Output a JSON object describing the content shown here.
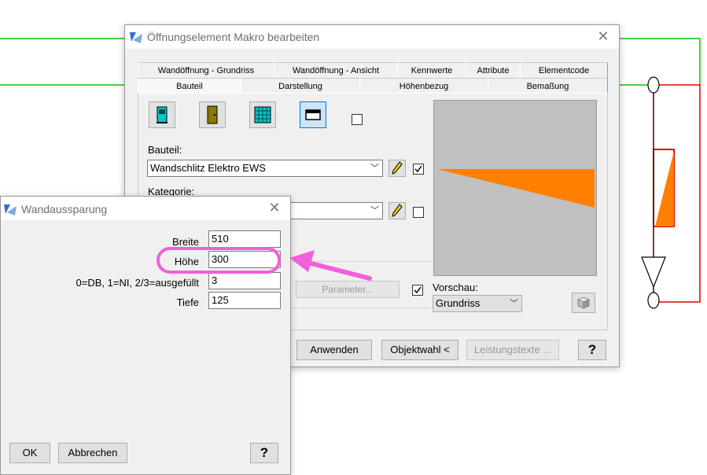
{
  "main_dialog": {
    "title": "Öffnungselement Makro bearbeiten",
    "tabs_row1": [
      "Wandöffnung - Grundriss",
      "Wandöffnung - Ansicht",
      "Kennwerte",
      "Attribute",
      "Elementcode"
    ],
    "tabs_row2": [
      "Bauteil",
      "Darstellung",
      "Höhenbezug",
      "Bemaßung"
    ],
    "bauteil_label": "Bauteil:",
    "bauteil_value": "Wandschlitz Elektro EWS",
    "kategorie_label": "Kategorie:",
    "parameter_button": "Parameter...",
    "vorschau_label": "Vorschau:",
    "vorschau_value": "Grundriss",
    "buttons": {
      "anwenden": "Anwenden",
      "objektwahl": "Objektwahl <",
      "leistungstexte": "Leistungstexte ...",
      "help": "?"
    }
  },
  "wand_dialog": {
    "title": "Wandaussparung",
    "fields": [
      {
        "label": "Breite",
        "value": "510"
      },
      {
        "label": "Höhe",
        "value": "300"
      },
      {
        "label": "0=DB, 1=NI, 2/3=ausgefüllt",
        "value": "3"
      },
      {
        "label": "Tiefe",
        "value": "125"
      }
    ],
    "buttons": {
      "ok": "OK",
      "abbrechen": "Abbrechen",
      "help": "?"
    }
  },
  "colors": {
    "cad_green": "#00c800",
    "cad_red": "#e00000",
    "preview_orange": "#ff8000",
    "annotation_magenta": "#f060d8",
    "accent_blue": "#0078d7"
  }
}
